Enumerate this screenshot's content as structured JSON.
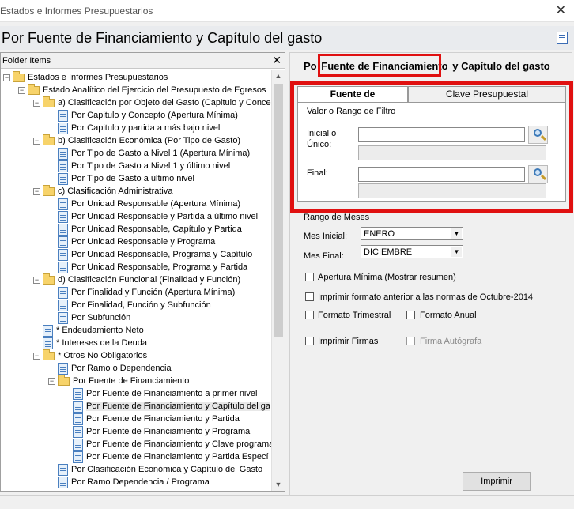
{
  "window": {
    "title": "Estados e Informes Presupuestarios",
    "close_glyph": "✕"
  },
  "header": {
    "title": "Por Fuente de Financiamiento y Capítulo del gasto"
  },
  "folder_pane": {
    "label": "Folder Items",
    "close_glyph": "✕",
    "nodes": [
      {
        "text": "Estados e Informes Presupuestarios",
        "icon": "folder-icon",
        "expander": "−"
      },
      {
        "text": "Estado Analítico del Ejercicio del Presupuesto de Egresos",
        "icon": "folder-icon",
        "expander": "−"
      },
      {
        "text": "a) Clasificación por Objeto del Gasto (Capitulo y Concep",
        "icon": "folder-icon",
        "expander": "−"
      },
      {
        "text": "Por Capitulo y Concepto (Apertura Mínima)",
        "icon": "document-icon"
      },
      {
        "text": "Por Capitulo y partida a más bajo nivel",
        "icon": "document-icon"
      },
      {
        "text": "b) Clasificación Económica (Por Tipo de Gasto)",
        "icon": "folder-icon",
        "expander": "−"
      },
      {
        "text": "Por Tipo de Gasto a Nivel 1  (Apertura Mínima)",
        "icon": "document-icon"
      },
      {
        "text": "Por Tipo de Gasto a Nivel 1 y último nivel",
        "icon": "document-icon"
      },
      {
        "text": "Por Tipo de Gasto a último nivel",
        "icon": "document-icon"
      },
      {
        "text": "c) Clasificación Administrativa",
        "icon": "folder-icon",
        "expander": "−"
      },
      {
        "text": "Por Unidad Responsable (Apertura Mínima)",
        "icon": "document-icon"
      },
      {
        "text": "Por Unidad Responsable y Partida a último nivel",
        "icon": "document-icon"
      },
      {
        "text": "Por Unidad Responsable, Capítulo y Partida",
        "icon": "document-icon"
      },
      {
        "text": "Por Unidad Responsable y Programa",
        "icon": "document-icon"
      },
      {
        "text": "Por Unidad Responsable, Programa y Capítulo",
        "icon": "document-icon"
      },
      {
        "text": "Por Unidad Responsable, Programa y Partida",
        "icon": "document-icon"
      },
      {
        "text": "d) Clasificación Funcional (Finalidad y Función)",
        "icon": "folder-icon",
        "expander": "−"
      },
      {
        "text": "Por Finalidad y Función  (Apertura Mínima)",
        "icon": "document-icon"
      },
      {
        "text": "Por Finalidad, Función y Subfunción",
        "icon": "document-icon"
      },
      {
        "text": "Por Subfunción",
        "icon": "document-icon"
      },
      {
        "text": "* Endeudamiento Neto",
        "icon": "document-icon"
      },
      {
        "text": "* Intereses de la Deuda",
        "icon": "document-icon"
      },
      {
        "text": "* Otros No Obligatorios",
        "icon": "folder-icon",
        "expander": "−"
      },
      {
        "text": "Por Ramo o Dependencia",
        "icon": "document-icon"
      },
      {
        "text": "Por Fuente de Financiamiento",
        "icon": "folder-icon",
        "expander": "−"
      },
      {
        "text": "Por Fuente de Financiamiento a primer nivel",
        "icon": "document-icon"
      },
      {
        "text": "Por Fuente de Financiamiento y Capítulo del ga",
        "icon": "document-icon",
        "selected": true
      },
      {
        "text": "Por Fuente de Financiamiento y Partida",
        "icon": "document-icon"
      },
      {
        "text": "Por Fuente de Financiamiento y Programa",
        "icon": "document-icon"
      },
      {
        "text": "Por Fuente de Financiamiento y Clave programa",
        "icon": "document-icon"
      },
      {
        "text": "Por Fuente de Financiamiento y Partida Especí",
        "icon": "document-icon"
      },
      {
        "text": "Por Clasificación Económica y Capítulo del Gasto",
        "icon": "document-icon"
      },
      {
        "text": "Por Ramo Dependencia / Programa",
        "icon": "document-icon"
      }
    ],
    "scroll_up": "▲",
    "scroll_down": "▼"
  },
  "panel": {
    "title_pre": "Po",
    "title_hl": "Fuente de Financiamiento",
    "title_post": "y Capítulo del gasto",
    "tabs": [
      {
        "label": "Fuente de Financiamiento",
        "active": true
      },
      {
        "label": "Clave Presupuestal",
        "active": false
      }
    ],
    "filter_caption": "Valor o Rango de Filtro",
    "inicial_label_1": "Inicial o",
    "inicial_label_2": "Único:",
    "final_label": "Final:",
    "inicial_value": "",
    "final_value": "",
    "rango_meses_label": "Rango de Meses",
    "mes_inicial_label": "Mes Inicial:",
    "mes_inicial_value": "ENERO",
    "mes_final_label": "Mes Final:",
    "mes_final_value": "DICIEMBRE",
    "dropdown_arrow": "▼",
    "checkboxes": {
      "apertura": "Apertura Mínima (Mostrar resumen)",
      "formato_anterior": "Imprimir formato anterior a las normas de Octubre-2014",
      "trimestral": "Formato Trimestral",
      "anual": "Formato Anual",
      "firmas": "Imprimir Firmas",
      "autografa": "Firma Autógrafa"
    },
    "print_button": "Imprimir"
  },
  "highlight_color": "#e01010"
}
